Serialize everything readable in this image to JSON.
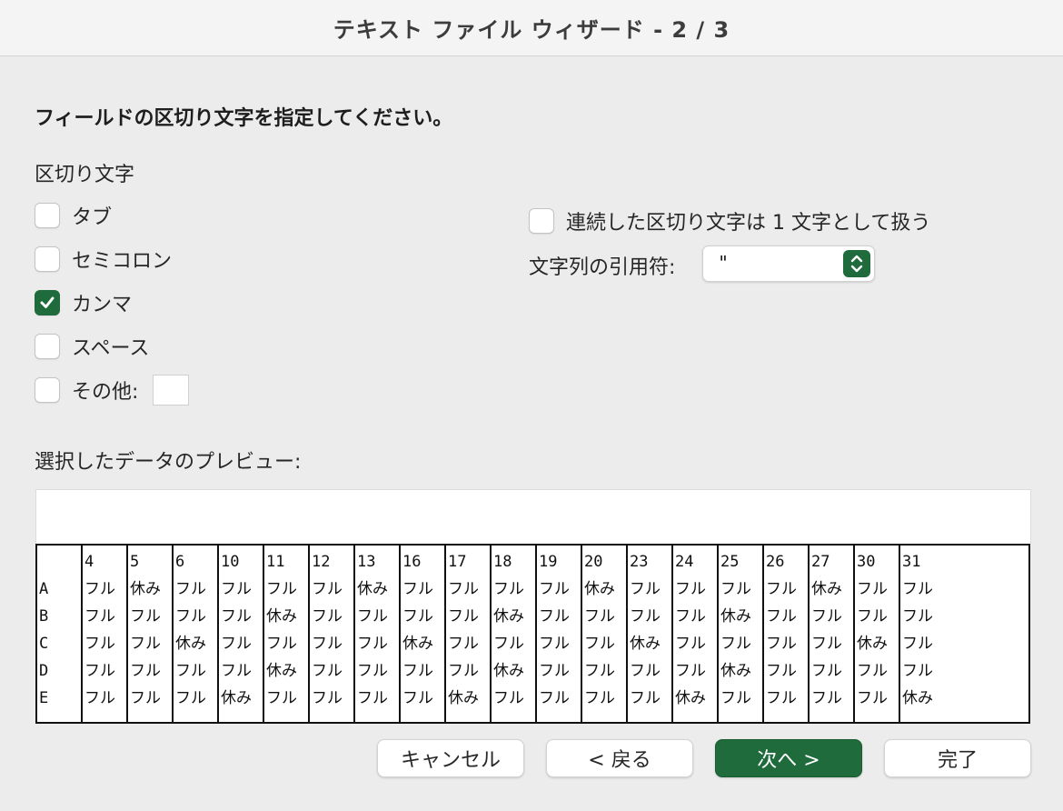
{
  "window": {
    "title": "テキスト ファイル ウィザード - 2 / 3"
  },
  "instruction": "フィールドの区切り文字を指定してください。",
  "delimiters": {
    "label": "区切り文字",
    "options": [
      {
        "label": "タブ",
        "checked": false
      },
      {
        "label": "セミコロン",
        "checked": false
      },
      {
        "label": "カンマ",
        "checked": true
      },
      {
        "label": "スペース",
        "checked": false
      },
      {
        "label": "その他:",
        "checked": false
      }
    ],
    "other_value": ""
  },
  "consecutive": {
    "label": "連続した区切り文字は 1 文字として扱う",
    "checked": false
  },
  "text_qualifier": {
    "label": "文字列の引用符:",
    "value": "\""
  },
  "preview": {
    "label": "選択したデータのプレビュー:",
    "columns": [
      [
        "",
        "A",
        "B",
        "C",
        "D",
        "E"
      ],
      [
        "4",
        "フル",
        "フル",
        "フル",
        "フル",
        "フル"
      ],
      [
        "5",
        "休み",
        "フル",
        "フル",
        "フル",
        "フル"
      ],
      [
        "6",
        "フル",
        "フル",
        "休み",
        "フル",
        "フル"
      ],
      [
        "10",
        "フル",
        "フル",
        "フル",
        "フル",
        "休み"
      ],
      [
        "11",
        "フル",
        "休み",
        "フル",
        "休み",
        "フル"
      ],
      [
        "12",
        "フル",
        "フル",
        "フル",
        "フル",
        "フル"
      ],
      [
        "13",
        "休み",
        "フル",
        "フル",
        "フル",
        "フル"
      ],
      [
        "16",
        "フル",
        "フル",
        "休み",
        "フル",
        "フル"
      ],
      [
        "17",
        "フル",
        "フル",
        "フル",
        "フル",
        "休み"
      ],
      [
        "18",
        "フル",
        "休み",
        "フル",
        "休み",
        "フル"
      ],
      [
        "19",
        "フル",
        "フル",
        "フル",
        "フル",
        "フル"
      ],
      [
        "20",
        "休み",
        "フル",
        "フル",
        "フル",
        "フル"
      ],
      [
        "23",
        "フル",
        "フル",
        "休み",
        "フル",
        "フル"
      ],
      [
        "24",
        "フル",
        "フル",
        "フル",
        "フル",
        "休み"
      ],
      [
        "25",
        "フル",
        "休み",
        "フル",
        "休み",
        "フル"
      ],
      [
        "26",
        "フル",
        "フル",
        "フル",
        "フル",
        "フル"
      ],
      [
        "27",
        "休み",
        "フル",
        "フル",
        "フル",
        "フル"
      ],
      [
        "30",
        "フル",
        "フル",
        "休み",
        "フル",
        "フル"
      ],
      [
        "31",
        "フル",
        "フル",
        "フル",
        "フル",
        "休み"
      ]
    ]
  },
  "buttons": {
    "cancel": "キャンセル",
    "back": "< 戻る",
    "next": "次へ >",
    "finish": "完了"
  },
  "colors": {
    "accent": "#1f6b3b"
  }
}
